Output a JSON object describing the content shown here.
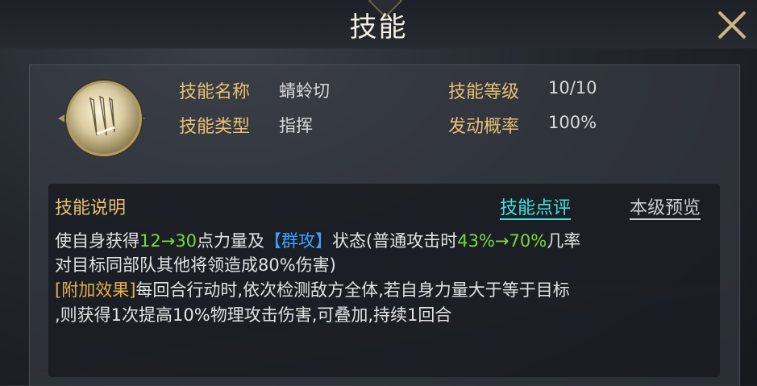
{
  "header": {
    "title": "技能"
  },
  "skill": {
    "icon": "claw-slash-icon",
    "name_label": "技能名称",
    "name": "蜻蛉切",
    "level_label": "技能等级",
    "level": "10/10",
    "type_label": "技能类型",
    "type": "指挥",
    "chance_label": "发动概率",
    "chance": "100%"
  },
  "description": {
    "title": "技能说明",
    "review_link": "技能点评",
    "preview_link": "本级预览",
    "line1": {
      "a": "使自身获得",
      "b": "12→30",
      "c": "点力量及",
      "d": "【群攻】",
      "e": "状态(普通攻击时",
      "f": "43%→70%",
      "g": "几率"
    },
    "line2": "对目标同部队其他将领造成80%伤害)",
    "line3": {
      "tag": "[附加效果]",
      "text": "每回合行动时,依次检测敌方全体,若自身力量大于等于目标"
    },
    "line4": ",则获得1次提高10%物理攻击伤害,可叠加,持续1回合"
  },
  "colors": {
    "label_gold": "#e8c070",
    "highlight_green": "#78d83c",
    "highlight_blue": "#3aa2ff",
    "link_cyan": "#45e0dd"
  }
}
